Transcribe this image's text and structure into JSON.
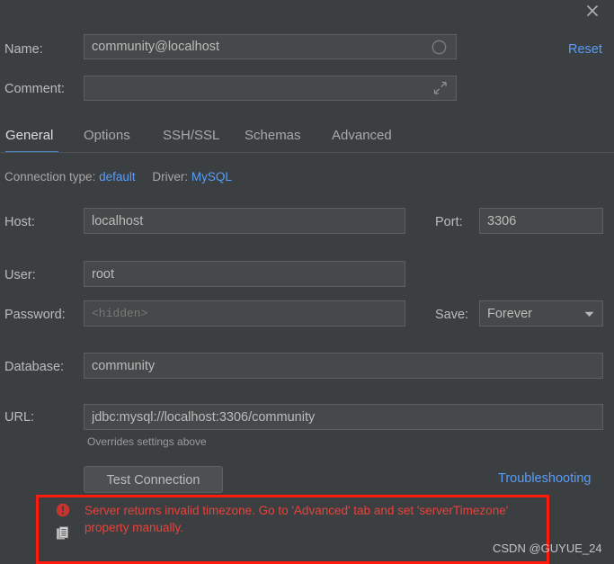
{
  "dialog": {
    "close_icon": "close-icon",
    "reset_label": "Reset"
  },
  "name_row": {
    "label": "Name:",
    "value": "community@localhost",
    "icon": "circle-color-icon"
  },
  "comment_row": {
    "label": "Comment:",
    "value": "",
    "placeholder": "",
    "icon": "expand-arrows-icon"
  },
  "tabs": [
    {
      "label": "General",
      "active": true
    },
    {
      "label": "Options",
      "active": false
    },
    {
      "label": "SSH/SSL",
      "active": false
    },
    {
      "label": "Schemas",
      "active": false
    },
    {
      "label": "Advanced",
      "active": false
    }
  ],
  "meta": {
    "connection_type_label": "Connection type:",
    "connection_type_value": "default",
    "driver_label": "Driver:",
    "driver_value": "MySQL"
  },
  "host_row": {
    "label": "Host:",
    "value": "localhost"
  },
  "port_row": {
    "label": "Port:",
    "value": "3306"
  },
  "user_row": {
    "label": "User:",
    "value": "root"
  },
  "password_row": {
    "label": "Password:",
    "value": "",
    "placeholder": "<hidden>"
  },
  "save_row": {
    "label": "Save:",
    "value": "Forever",
    "arrow_icon": "chevron-down-icon"
  },
  "database_row": {
    "label": "Database:",
    "value": "community"
  },
  "url_row": {
    "label": "URL:",
    "value": "jdbc:mysql://localhost:3306/community",
    "hint": "Overrides settings above"
  },
  "actions": {
    "test_connection_label": "Test Connection",
    "troubleshooting_label": "Troubleshooting"
  },
  "error": {
    "icon": "error-circle-icon",
    "copy_icon": "copy-icon",
    "message": "Server returns invalid timezone. Go to 'Advanced' tab and set 'serverTimezone' property manually."
  },
  "watermark": {
    "text": "CSDN @GUYUE_24"
  },
  "colors": {
    "background": "#3c3f41",
    "field_background": "#45494a",
    "accent_link": "#589df6",
    "tab_underline": "#4a88c7",
    "error_text": "#e8413a",
    "annotation": "#ff1a0e"
  }
}
